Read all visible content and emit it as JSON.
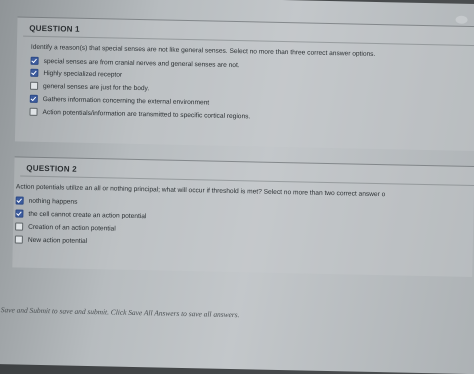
{
  "question1": {
    "title": "QUESTION 1",
    "prompt": "Identify a reason(s) that special senses are not like general senses.  Select no more than three correct answer options.",
    "options": [
      {
        "label": "special senses are from cranial nerves and general senses are not.",
        "checked": true
      },
      {
        "label": "Highly specialized receptor",
        "checked": true
      },
      {
        "label": "general senses are just for the body.",
        "checked": false
      },
      {
        "label": "Gathers information concerning the external environment",
        "checked": true
      },
      {
        "label": "Action potentials/information are transmitted to specific cortical regions.",
        "checked": false
      }
    ]
  },
  "question2": {
    "title": "QUESTION 2",
    "prompt": "Action potentials utilize an all or nothing principal; what will occur if threshold is met?  Select no more than two correct answer o",
    "options": [
      {
        "label": "nothing happens",
        "checked": true
      },
      {
        "label": "the cell cannot create an action potential",
        "checked": true
      },
      {
        "label": "Creation of an action potential",
        "checked": false
      },
      {
        "label": "New action potential",
        "checked": false
      }
    ]
  },
  "footer": {
    "instructions": "Click Save and Submit to save and submit. Click Save All Answers to save all answers."
  },
  "colors": {
    "checkbox_checked": "#3d5c9e",
    "text": "#2c3134"
  }
}
